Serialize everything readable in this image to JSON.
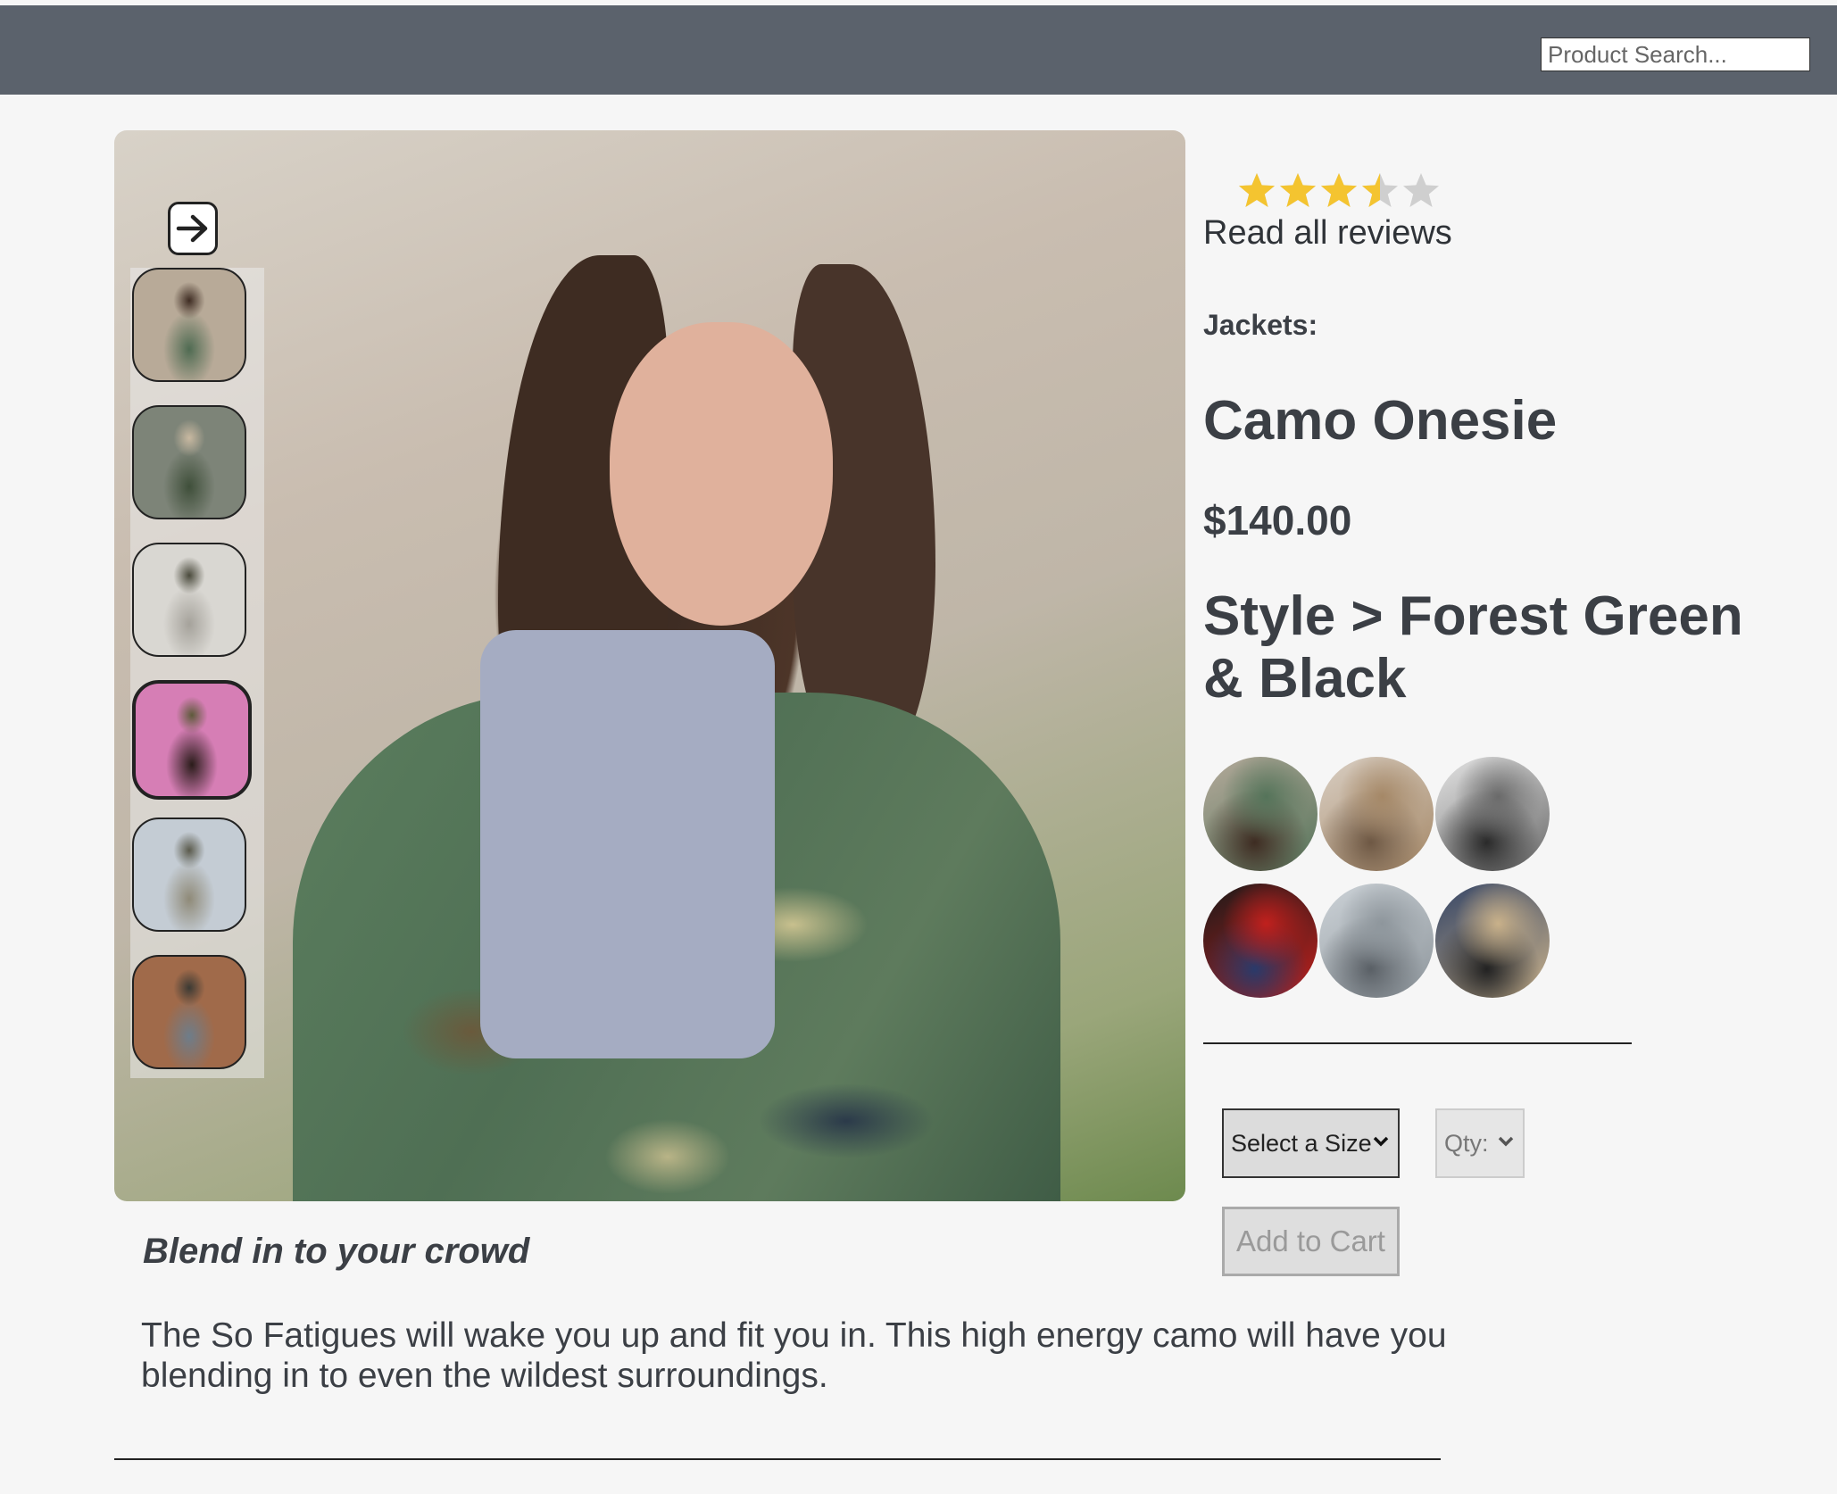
{
  "header": {
    "search_placeholder": "Product Search..."
  },
  "gallery": {
    "next_icon": "arrow-right-icon",
    "thumbnails": [
      {
        "name": "thumb-1",
        "colors": [
          "#b8aa98",
          "#4f6b52",
          "#3e2c22"
        ]
      },
      {
        "name": "thumb-2",
        "colors": [
          "#7d8478",
          "#3f4f3a",
          "#c9b9a1"
        ]
      },
      {
        "name": "thumb-3",
        "colors": [
          "#d9d7d2",
          "#a5a29b",
          "#4a4a3c"
        ]
      },
      {
        "name": "thumb-4",
        "colors": [
          "#d67eb5",
          "#2a1c1a",
          "#5d5a3a"
        ]
      },
      {
        "name": "thumb-5",
        "colors": [
          "#c4ccd4",
          "#8f8a78",
          "#5a5a4c"
        ]
      },
      {
        "name": "thumb-6",
        "colors": [
          "#a06a4a",
          "#6e7d8a",
          "#3b3a34"
        ]
      }
    ],
    "selected_thumb_index": 3
  },
  "rating": {
    "value": 3.5,
    "max": 5,
    "filled_color": "#f4c430",
    "empty_color": "#cfcfcf",
    "reviews_link": "Read all reviews"
  },
  "product": {
    "category": "Jackets:",
    "name": "Camo Onesie",
    "price": "$140.00",
    "style_label": "Style > Forest Green & Black"
  },
  "styles": [
    {
      "name": "style-1",
      "colors": [
        "#b5aa9b",
        "#55745a",
        "#3e2c22"
      ]
    },
    {
      "name": "style-2",
      "colors": [
        "#d9cfc4",
        "#a58867",
        "#6e5844"
      ]
    },
    {
      "name": "style-3",
      "colors": [
        "#e5e5e5",
        "#6a6a6a",
        "#2a2a2a"
      ]
    },
    {
      "name": "style-4",
      "colors": [
        "#1a1a1a",
        "#c0201d",
        "#2a3a6a"
      ]
    },
    {
      "name": "style-5",
      "colors": [
        "#cdd3d8",
        "#8e969c",
        "#5a6066"
      ]
    },
    {
      "name": "style-6",
      "colors": [
        "#334466",
        "#c9b18a",
        "#222222"
      ]
    }
  ],
  "cart": {
    "size_label": "Select a Size",
    "qty_label": "Qty:",
    "add_to_cart": "Add to Cart"
  },
  "description": {
    "tagline": "Blend in to your crowd",
    "body": "The So Fatigues will wake you up and fit you in. This high energy camo will have you blending in to even the wildest surroundings."
  }
}
